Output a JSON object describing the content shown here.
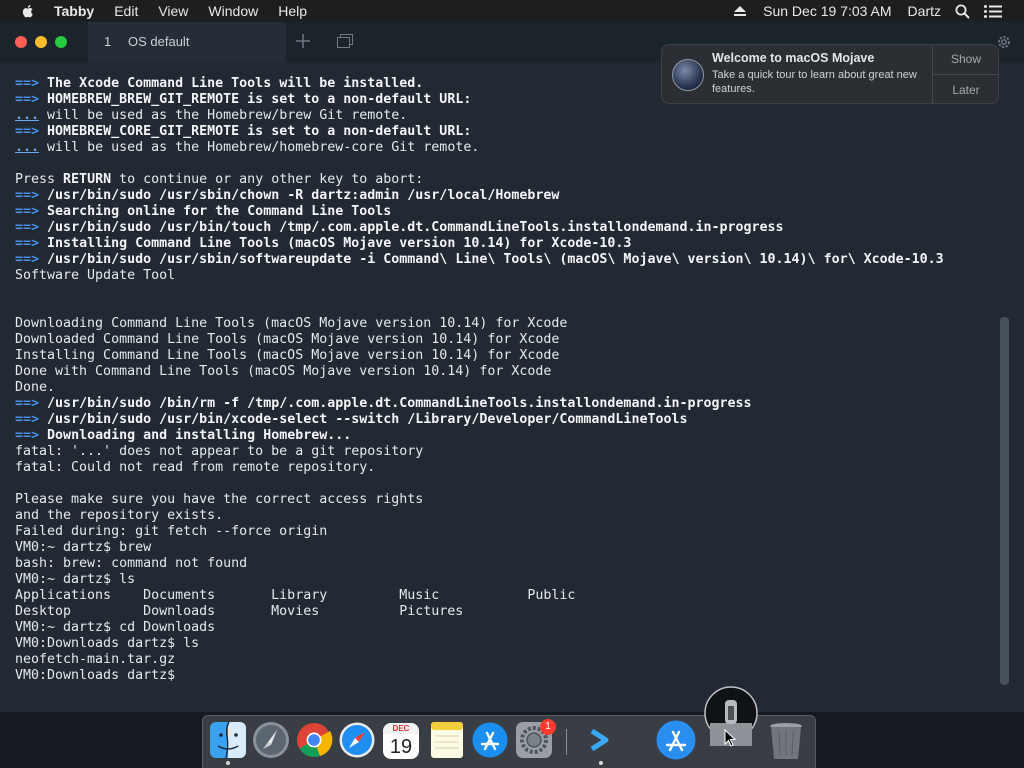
{
  "menubar": {
    "app_name": "Tabby",
    "items": [
      "Edit",
      "View",
      "Window",
      "Help"
    ],
    "clock": "Sun Dec 19  7:03 AM",
    "user": "Dartz"
  },
  "tabs": [
    {
      "number": "1",
      "title": "OS default"
    }
  ],
  "notification": {
    "title": "Welcome to macOS Mojave",
    "body": "Take a quick tour to learn about great new features.",
    "show_label": "Show",
    "later_label": "Later"
  },
  "terminal_lines": [
    {
      "type": "arrow",
      "text": "The Xcode Command Line Tools will be installed."
    },
    {
      "type": "arrow",
      "text": "HOMEBREW_BREW_GIT_REMOTE is set to a non-default URL:"
    },
    {
      "type": "dots",
      "text": "will be used as the Homebrew/brew Git remote."
    },
    {
      "type": "arrow",
      "text": "HOMEBREW_CORE_GIT_REMOTE is set to a non-default URL:"
    },
    {
      "type": "dots",
      "text": "will be used as the Homebrew/homebrew-core Git remote."
    },
    {
      "type": "plain",
      "text": ""
    },
    {
      "type": "return",
      "pre": "Press ",
      "bold": "RETURN",
      "post": " to continue or any other key to abort:"
    },
    {
      "type": "arrow",
      "text": "/usr/bin/sudo /usr/sbin/chown -R dartz:admin /usr/local/Homebrew"
    },
    {
      "type": "arrow",
      "text": "Searching online for the Command Line Tools"
    },
    {
      "type": "arrow",
      "text": "/usr/bin/sudo /usr/bin/touch /tmp/.com.apple.dt.CommandLineTools.installondemand.in-progress"
    },
    {
      "type": "arrow",
      "text": "Installing Command Line Tools (macOS Mojave version 10.14) for Xcode-10.3"
    },
    {
      "type": "arrow",
      "text": "/usr/bin/sudo /usr/sbin/softwareupdate -i Command\\ Line\\ Tools\\ (macOS\\ Mojave\\ version\\ 10.14)\\ for\\ Xcode-10.3"
    },
    {
      "type": "plain",
      "text": "Software Update Tool"
    },
    {
      "type": "plain",
      "text": ""
    },
    {
      "type": "plain",
      "text": ""
    },
    {
      "type": "plain",
      "text": "Downloading Command Line Tools (macOS Mojave version 10.14) for Xcode"
    },
    {
      "type": "plain",
      "text": "Downloaded Command Line Tools (macOS Mojave version 10.14) for Xcode"
    },
    {
      "type": "plain",
      "text": "Installing Command Line Tools (macOS Mojave version 10.14) for Xcode"
    },
    {
      "type": "plain",
      "text": "Done with Command Line Tools (macOS Mojave version 10.14) for Xcode"
    },
    {
      "type": "plain",
      "text": "Done."
    },
    {
      "type": "arrow",
      "text": "/usr/bin/sudo /bin/rm -f /tmp/.com.apple.dt.CommandLineTools.installondemand.in-progress"
    },
    {
      "type": "arrow",
      "text": "/usr/bin/sudo /usr/bin/xcode-select --switch /Library/Developer/CommandLineTools"
    },
    {
      "type": "arrow",
      "text": "Downloading and installing Homebrew..."
    },
    {
      "type": "plain",
      "text": "fatal: '...' does not appear to be a git repository"
    },
    {
      "type": "plain",
      "text": "fatal: Could not read from remote repository."
    },
    {
      "type": "plain",
      "text": ""
    },
    {
      "type": "plain",
      "text": "Please make sure you have the correct access rights"
    },
    {
      "type": "plain",
      "text": "and the repository exists."
    },
    {
      "type": "plain",
      "text": "Failed during: git fetch --force origin"
    },
    {
      "type": "plain",
      "text": "VM0:~ dartz$ brew"
    },
    {
      "type": "plain",
      "text": "bash: brew: command not found"
    },
    {
      "type": "plain",
      "text": "VM0:~ dartz$ ls"
    },
    {
      "type": "plain",
      "text": "Applications    Documents       Library         Music           Public"
    },
    {
      "type": "plain",
      "text": "Desktop         Downloads       Movies          Pictures"
    },
    {
      "type": "plain",
      "text": "VM0:~ dartz$ cd Downloads"
    },
    {
      "type": "plain",
      "text": "VM0:Downloads dartz$ ls"
    },
    {
      "type": "plain",
      "text": "neofetch-main.tar.gz"
    },
    {
      "type": "plain",
      "text": "VM0:Downloads dartz$"
    }
  ],
  "terminal_markers": {
    "arrow": "==>",
    "dots": "..."
  },
  "dock": {
    "calendar_month": "DEC",
    "calendar_day": "19",
    "badge_count": "1",
    "items": [
      "finder-icon",
      "launchpad-icon",
      "chrome-icon",
      "safari-icon",
      "calendar-icon",
      "notes-icon",
      "app-store-icon",
      "system-preferences-icon",
      "tabby-icon",
      "app-store-downloads-icon",
      "downloads-stack-icon",
      "trash-icon"
    ]
  },
  "colors": {
    "accent_arrow": "#4a8ee6",
    "terminal_bg": "#212a32"
  }
}
